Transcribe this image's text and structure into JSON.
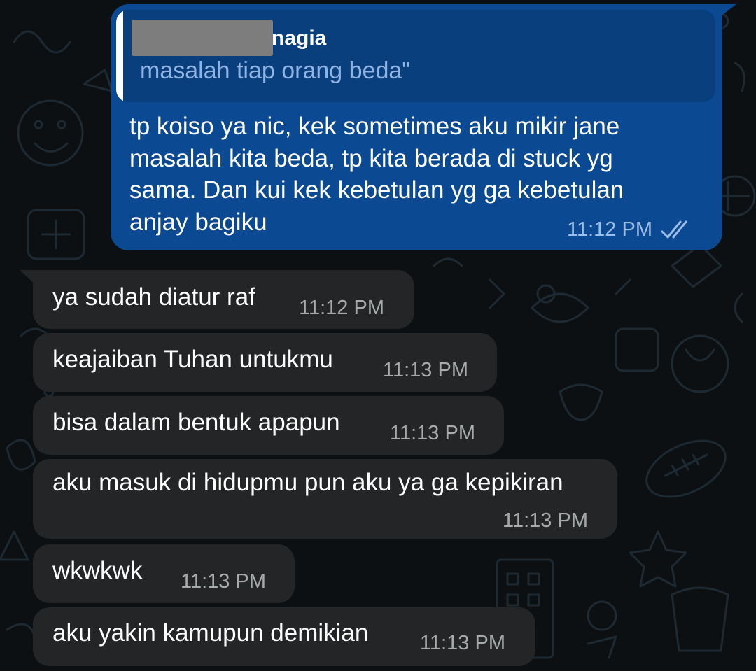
{
  "quoted_message": {
    "sender_visible": "nagia",
    "text": "masalah tiap orang beda\""
  },
  "outgoing_message": {
    "text": "tp koiso ya nic, kek sometimes aku mikir jane\nmasalah kita beda, tp kita berada di stuck yg\nsama. Dan kui kek kebetulan yg ga kebetulan\nanjay bagiku",
    "time": "11:12 PM",
    "status_icon": "double-check-icon"
  },
  "incoming_messages": [
    {
      "text": "ya sudah diatur raf",
      "time": "11:12 PM"
    },
    {
      "text": "keajaiban Tuhan untukmu",
      "time": "11:13 PM"
    },
    {
      "text": "bisa dalam bentuk apapun",
      "time": "11:13 PM"
    },
    {
      "text": "aku masuk di hidupmu pun aku ya ga kepikiran",
      "time": "11:13 PM"
    },
    {
      "text": "wkwkwk",
      "time": "11:13 PM"
    },
    {
      "text": "aku yakin kamupun demikian",
      "time": "11:13 PM"
    }
  ],
  "colors": {
    "outgoing_bubble": "#0b4a92",
    "incoming_bubble": "#232526",
    "background": "#0d1012"
  }
}
